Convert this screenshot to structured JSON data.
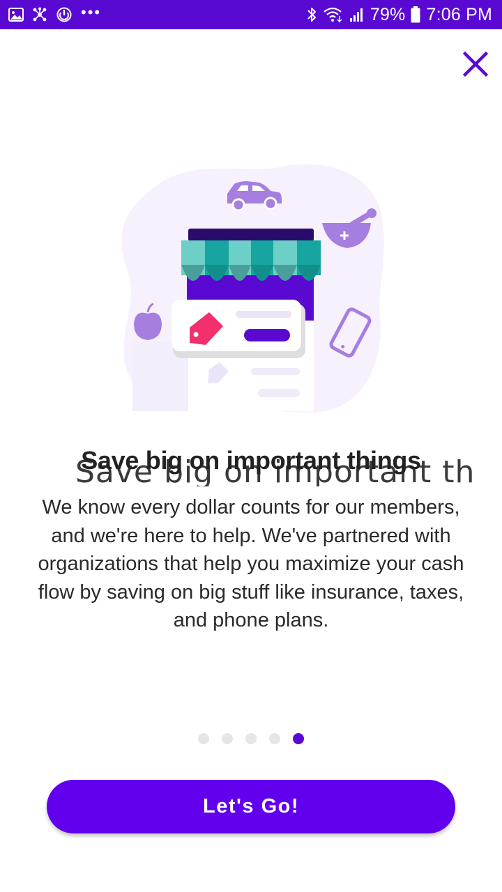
{
  "status_bar": {
    "battery": "79%",
    "time": "7:06 PM",
    "more": "•••",
    "icons": [
      "image-icon",
      "network-icon",
      "sync-icon",
      "more-icon",
      "bluetooth-icon",
      "wifi-icon",
      "signal-icon",
      "battery-icon"
    ]
  },
  "close_icon": "close-icon",
  "title": "Save big on important things",
  "title_ghost": "Save big on important th",
  "description": "We know every dollar counts for our members, and we're here to help. We've partnered with organizations that help you maximize your cash flow by saving on big stuff like insurance, taxes, and phone plans.",
  "pager": {
    "total": 5,
    "active": 5
  },
  "cta": {
    "label": "Let's Go!"
  },
  "colors": {
    "brand": "#5a09d3",
    "cta": "#6200ee",
    "accent_teal": "#2bb0a3",
    "accent_pink": "#f2306b",
    "lavender": "#a57ee0"
  }
}
